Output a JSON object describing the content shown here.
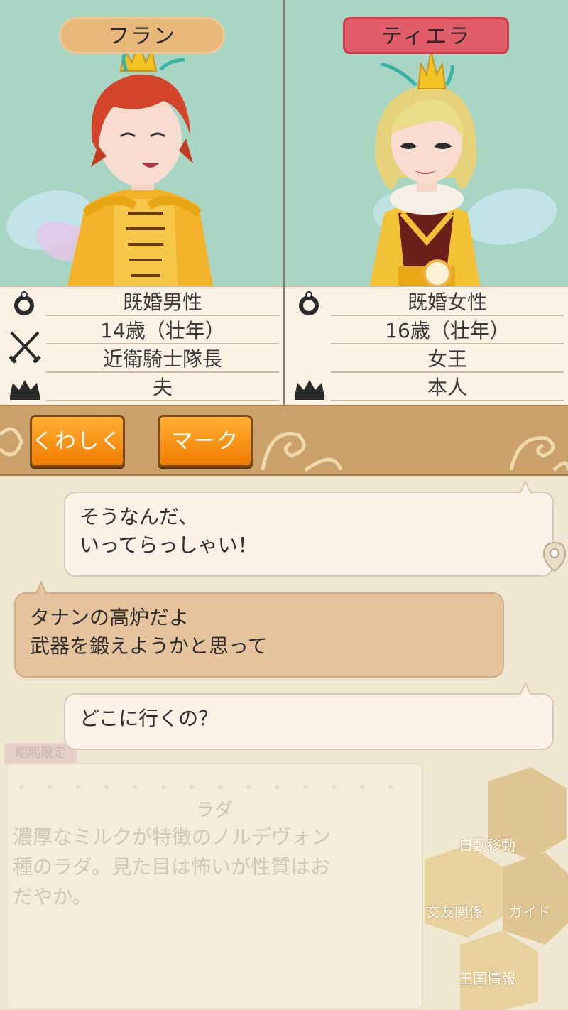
{
  "characters": {
    "left": {
      "name": "フラン",
      "status": "既婚男性",
      "age": "14歳（壮年）",
      "job": "近衛騎士隊長",
      "relation": "夫"
    },
    "right": {
      "name": "ティエラ",
      "status": "既婚女性",
      "age": "16歳（壮年）",
      "job": "女王",
      "relation": "本人"
    }
  },
  "icons": {
    "status": "ring-icon",
    "job": "crossed-swords-icon",
    "relation": "crown-icon"
  },
  "buttons": {
    "details": "くわしく",
    "mark": "マーク"
  },
  "chat": [
    {
      "speaker": "right",
      "style": "light",
      "lines": [
        "そうなんだ、",
        "いってらっしゃい！"
      ]
    },
    {
      "speaker": "left",
      "style": "tan",
      "lines": [
        "タナンの高炉だよ",
        "武器を鍛えようかと思って"
      ]
    },
    {
      "speaker": "right",
      "style": "light",
      "lines": [
        "どこに行くの？"
      ]
    }
  ],
  "background_card": {
    "badge": "期間限定",
    "title": "ラダ",
    "description": [
      "濃厚なミルクが特徴のノルデヴォン",
      "種のラダ。見た目は怖いが性質はお",
      "だやか。"
    ]
  },
  "menu": {
    "auto_move": "自動移動",
    "relations": "交友関係",
    "guide": "ガイド",
    "kingdom_info": "王国情報"
  },
  "colors": {
    "portrait_bg": "#a8d5c4",
    "button_orange": "#f49a14",
    "band": "#caa16a",
    "bubble_light": "#fbf1e6",
    "bubble_tan": "#e5c39d"
  }
}
